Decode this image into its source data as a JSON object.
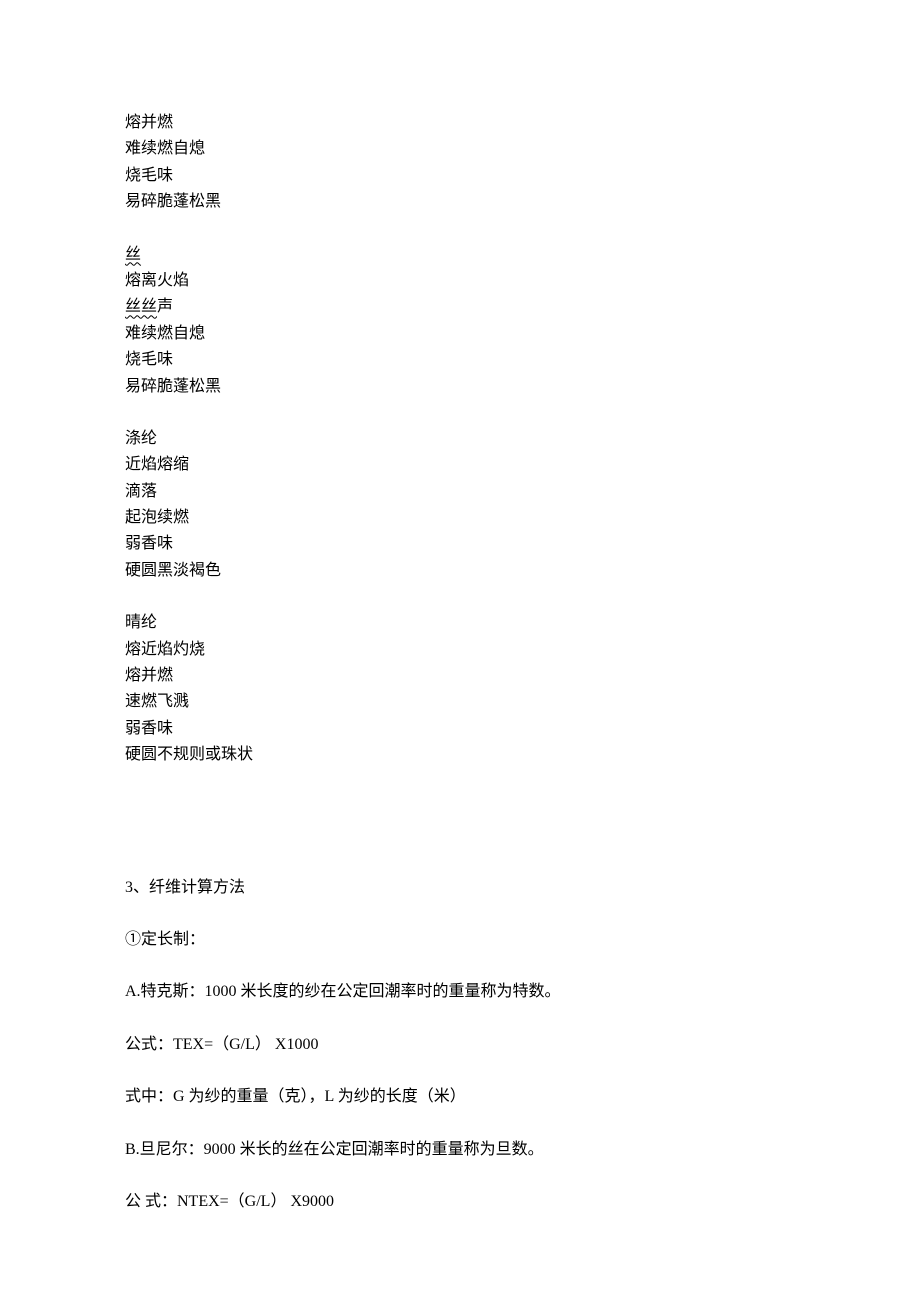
{
  "group1": {
    "l1": "熔并燃",
    "l2": "难续燃自熄",
    "l3": "烧毛味",
    "l4": "易碎脆蓬松黑"
  },
  "group2": {
    "l1": "丝",
    "l2": "熔离火焰",
    "l3a": "丝丝",
    "l3b": "声",
    "l4": "难续燃自熄",
    "l5": "烧毛味",
    "l6": "易碎脆蓬松黑"
  },
  "group3": {
    "l1": "涤纶",
    "l2": "近焰熔缩",
    "l3": "滴落",
    "l4": "起泡续燃",
    "l5": "弱香味",
    "l6": "硬圆黑淡褐色"
  },
  "group4": {
    "l1": "晴纶",
    "l2": "熔近焰灼烧",
    "l3": "熔并燃",
    "l4": "速燃飞溅",
    "l5": "弱香味",
    "l6": "硬圆不规则或珠状"
  },
  "section3": {
    "title": "3、纤维计算方法",
    "sub1": "①定长制：",
    "a": "A.特克斯：1000 米长度的纱在公定回潮率时的重量称为特数。",
    "formula_a": "公式：TEX=（G/L） X1000",
    "desc_a": "式中：G 为纱的重量（克），L 为纱的长度（米）",
    "b": "B.旦尼尔：9000 米长的丝在公定回潮率时的重量称为旦数。",
    "formula_b": "公 式：NTEX=（G/L） X9000"
  }
}
